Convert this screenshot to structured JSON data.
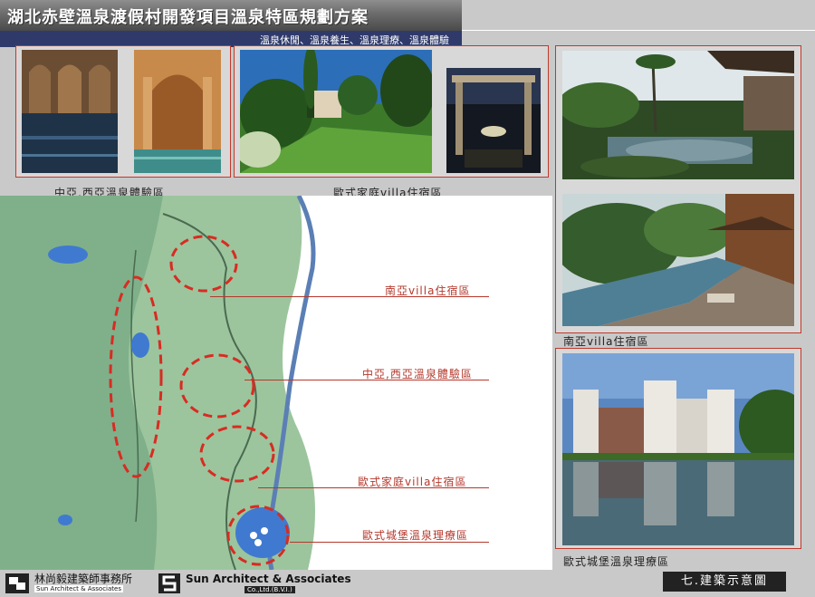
{
  "header": {
    "title": "湖北赤壁溫泉渡假村開發項目溫泉特區規劃方案",
    "subtitle": "溫泉休閒、溫泉養生、溫泉理療、溫泉體驗"
  },
  "photos": {
    "caption_central_west_asia": "中亞,西亞溫泉體驗區",
    "caption_european_villa": "歐式家庭villa住宿區",
    "caption_south_asia_villa": "南亞villa住宿區",
    "caption_castle": "歐式城堡溫泉理療區"
  },
  "map": {
    "callouts": [
      "南亞villa住宿區",
      "中亞,西亞溫泉體驗區",
      "歐式家庭villa住宿區",
      "歐式城堡溫泉理療區"
    ]
  },
  "footer": {
    "firm_zh": "林尚毅建築師事務所",
    "firm_en_small": "Sun Architect & Associates",
    "firm_en": "Sun Architect & Associates",
    "firm_co": "Co.,Ltd.(B.V.I.)",
    "section": "七.建築示意圖"
  },
  "colors": {
    "accent_red": "#c0392b",
    "header_blue": "#2f3a6b",
    "map_green": "#7fb08a"
  }
}
